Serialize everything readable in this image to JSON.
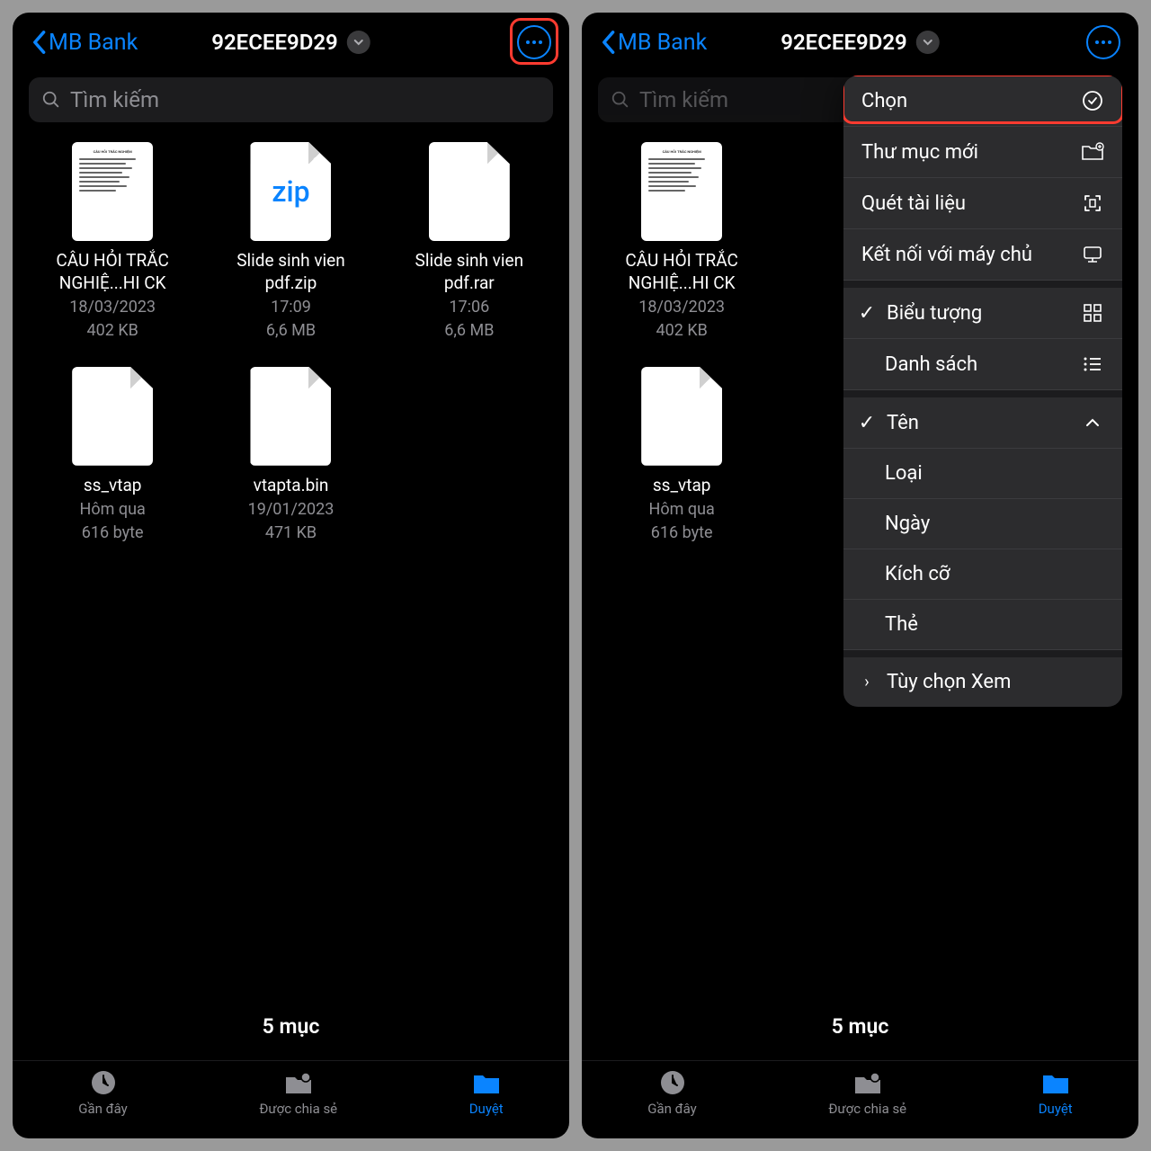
{
  "header": {
    "back_label": "MB Bank",
    "title": "92ECEE9D29"
  },
  "search": {
    "placeholder": "Tìm kiếm"
  },
  "files": [
    {
      "name": "CÂU HỎI TRẮC NGHIỆ...HI CK",
      "date": "18/03/2023",
      "size": "402 KB",
      "type": "doc"
    },
    {
      "name": "Slide sinh vien pdf.zip",
      "date": "17:09",
      "size": "6,6 MB",
      "type": "zip"
    },
    {
      "name": "Slide sinh vien pdf.rar",
      "date": "17:06",
      "size": "6,6 MB",
      "type": "generic"
    },
    {
      "name": "ss_vtap",
      "date": "Hôm qua",
      "size": "616 byte",
      "type": "generic"
    },
    {
      "name": "vtapta.bin",
      "date": "19/01/2023",
      "size": "471 KB",
      "type": "generic"
    }
  ],
  "footer": {
    "count": "5 mục"
  },
  "tabs": [
    {
      "label": "Gần đây",
      "active": false
    },
    {
      "label": "Được chia sẻ",
      "active": false
    },
    {
      "label": "Duyệt",
      "active": true
    }
  ],
  "menu": {
    "items": [
      {
        "label": "Chọn",
        "icon": "check-circle"
      },
      {
        "label": "Thư mục mới",
        "icon": "folder-plus"
      },
      {
        "label": "Quét tài liệu",
        "icon": "scan"
      },
      {
        "label": "Kết nối với máy chủ",
        "icon": "server"
      }
    ],
    "view": [
      {
        "label": "Biểu tượng",
        "checked": true,
        "icon": "grid"
      },
      {
        "label": "Danh sách",
        "checked": false,
        "icon": "list"
      }
    ],
    "sort": [
      {
        "label": "Tên",
        "checked": true,
        "icon": "up"
      },
      {
        "label": "Loại",
        "checked": false
      },
      {
        "label": "Ngày",
        "checked": false
      },
      {
        "label": "Kích cỡ",
        "checked": false
      },
      {
        "label": "Thẻ",
        "checked": false
      }
    ],
    "more": {
      "label": "Tùy chọn Xem"
    }
  }
}
